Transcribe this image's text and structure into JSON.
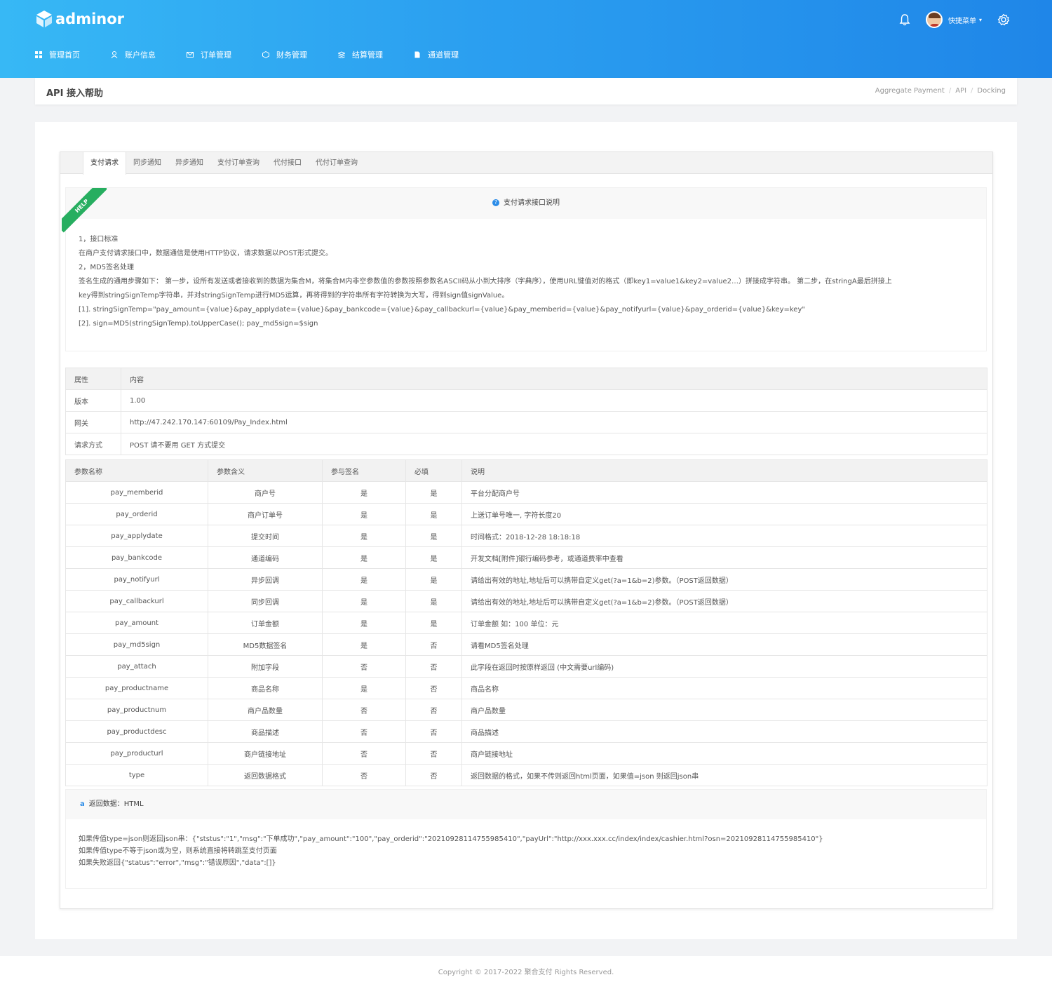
{
  "brand": {
    "name": "adminor"
  },
  "nav": [
    {
      "label": "管理首页",
      "icon": "dashboard-icon"
    },
    {
      "label": "账户信息",
      "icon": "user-icon"
    },
    {
      "label": "订单管理",
      "icon": "mail-icon"
    },
    {
      "label": "财务管理",
      "icon": "wallet-icon"
    },
    {
      "label": "结算管理",
      "icon": "layers-icon"
    },
    {
      "label": "通道管理",
      "icon": "document-icon"
    }
  ],
  "header": {
    "quick_menu": "快捷菜单"
  },
  "page": {
    "title": "API 接入帮助",
    "breadcrumb": [
      "Aggregate Payment",
      "API",
      "Docking"
    ]
  },
  "tabs": [
    "支付请求",
    "同步通知",
    "异步通知",
    "支付订单查询",
    "代付接口",
    "代付订单查询"
  ],
  "help": {
    "ribbon": "HELP",
    "title": "支付请求接口说明",
    "lines": [
      "1，接口标准",
      "在商户支付请求接口中，数据通信是使用HTTP协议，请求数据以POST形式提交。",
      "2，MD5签名处理",
      "签名生成的通用步骤如下：  第一步，设所有发送或者接收到的数据为集合M，将集合M内非空参数值的参数按照参数名ASCII码从小到大排序（字典序），使用URL键值对的格式（即key1=value1&key2=value2…）拼接成字符串。  第二步，在stringA最后拼接上",
      "key得到stringSignTemp字符串，并对stringSignTemp进行MD5运算，再将得到的字符串所有字符转换为大写，得到sign值signValue。",
      "[1]. stringSignTemp=\"pay_amount={value}&pay_applydate={value}&pay_bankcode={value}&pay_callbackurl={value}&pay_memberid={value}&pay_notifyurl={value}&pay_orderid={value}&key=key\"",
      "[2]. sign=MD5(stringSignTemp).toUpperCase(); pay_md5sign=$sign"
    ]
  },
  "info_table": {
    "headers": [
      "属性",
      "内容"
    ],
    "rows": [
      [
        "版本",
        "1.00"
      ],
      [
        "网关",
        "http://47.242.170.147:60109/Pay_Index.html"
      ],
      [
        "请求方式",
        "POST 请不要用 GET 方式提交"
      ]
    ]
  },
  "param_table": {
    "headers": [
      "参数名称",
      "参数含义",
      "参与签名",
      "必填",
      "说明"
    ],
    "rows": [
      [
        "pay_memberid",
        "商户号",
        "是",
        "是",
        "平台分配商户号"
      ],
      [
        "pay_orderid",
        "商户订单号",
        "是",
        "是",
        "上送订单号唯一, 字符长度20"
      ],
      [
        "pay_applydate",
        "提交时间",
        "是",
        "是",
        "时间格式：2018-12-28 18:18:18"
      ],
      [
        "pay_bankcode",
        "通道编码",
        "是",
        "是",
        "开发文档[附件]银行编码参考，或通道费率中查看"
      ],
      [
        "pay_notifyurl",
        "异步回调",
        "是",
        "是",
        "请给出有效的地址,地址后可以携带自定义get(?a=1&b=2)参数。（POST返回数据）"
      ],
      [
        "pay_callbackurl",
        "同步回调",
        "是",
        "是",
        "请给出有效的地址,地址后可以携带自定义get(?a=1&b=2)参数。（POST返回数据）"
      ],
      [
        "pay_amount",
        "订单金额",
        "是",
        "是",
        "订单金额 如：100 单位：元"
      ],
      [
        "pay_md5sign",
        "MD5数据签名",
        "是",
        "否",
        "请看MD5签名处理"
      ],
      [
        "pay_attach",
        "附加字段",
        "否",
        "否",
        "此字段在返回时按原样返回 (中文需要url编码)"
      ],
      [
        "pay_productname",
        "商品名称",
        "是",
        "否",
        "商品名称"
      ],
      [
        "pay_productnum",
        "商户品数量",
        "否",
        "否",
        "商户品数量"
      ],
      [
        "pay_productdesc",
        "商品描述",
        "否",
        "否",
        "商品描述"
      ],
      [
        "pay_producturl",
        "商户链接地址",
        "否",
        "否",
        "商户链接地址"
      ],
      [
        "type",
        "返回数据格式",
        "否",
        "否",
        "返回数据的格式，如果不传则返回html页面，如果值=json 则返回json串"
      ]
    ]
  },
  "return_box": {
    "title": "返回数据：HTML",
    "lines": [
      "如果传值type=json则返回json串：{\"ststus\":\"1\",\"msg\":\"下单成功\",\"pay_amount\":\"100\",\"pay_orderid\":\"20210928114755985410\",\"payUrl\":\"http://xxx.xxx.cc/index/index/cashier.html?osn=20210928114755985410\"}",
      "如果传值type不等于json或为空，则系统直接将转跳至支付页面",
      "如果失败返回{\"status\":\"error\",\"msg\":\"错误原因\",\"data\":[]}"
    ]
  },
  "footer": {
    "copyright": "Copyright © 2017-2022 聚合支付 Rights Reserved."
  }
}
